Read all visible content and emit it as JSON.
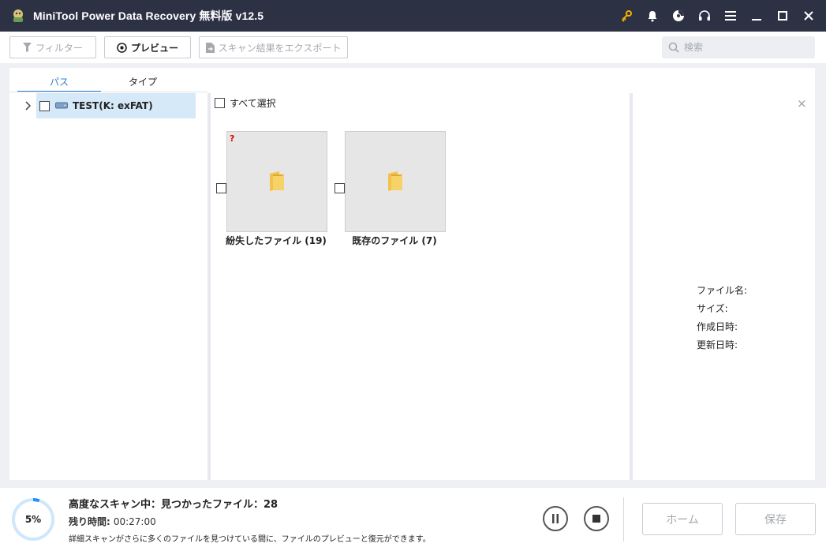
{
  "window": {
    "title": "MiniTool Power Data Recovery 無料版 v12.5",
    "icons": [
      "key-icon",
      "bell-icon",
      "disc-icon",
      "headset-icon",
      "menu-icon",
      "minimize-icon",
      "maximize-icon",
      "close-icon"
    ]
  },
  "toolbar": {
    "filter_label": "フィルター",
    "preview_label": "プレビュー",
    "export_label": "スキャン結果をエクスポート",
    "search_placeholder": "検索"
  },
  "left_panel": {
    "tabs": [
      {
        "label": "パス",
        "active": true
      },
      {
        "label": "タイプ",
        "active": false
      }
    ],
    "tree": [
      {
        "label": "TEST(K: exFAT)",
        "selected": true,
        "checked": false,
        "icon": "drive-icon"
      }
    ]
  },
  "file_view": {
    "select_all_label": "すべて選択",
    "items": [
      {
        "label": "紛失したファイル (19)",
        "icon": "folder-icon",
        "badge": "?"
      },
      {
        "label": "既存のファイル (7)",
        "icon": "folder-icon",
        "badge": ""
      }
    ]
  },
  "details": {
    "close": "×",
    "labels": [
      "ファイル名:",
      "サイズ:",
      "作成日時:",
      "更新日時:"
    ]
  },
  "status": {
    "progress_text": "5%",
    "progress_value": 0.05,
    "scan_title": "高度なスキャン中：見つかったファイル：28",
    "remaining_label": "残り時間:",
    "remaining_value": "00:27:00",
    "hint": "詳細スキャンがさらに多くのファイルを見つけている間に、ファイルのプレビューと復元ができます。",
    "home_label": "ホーム",
    "save_label": "保存"
  },
  "colors": {
    "titlebar": "#2d3144",
    "accent": "#2f7fd0",
    "selection": "#d6e9f8",
    "progress": "#1e90ff"
  }
}
